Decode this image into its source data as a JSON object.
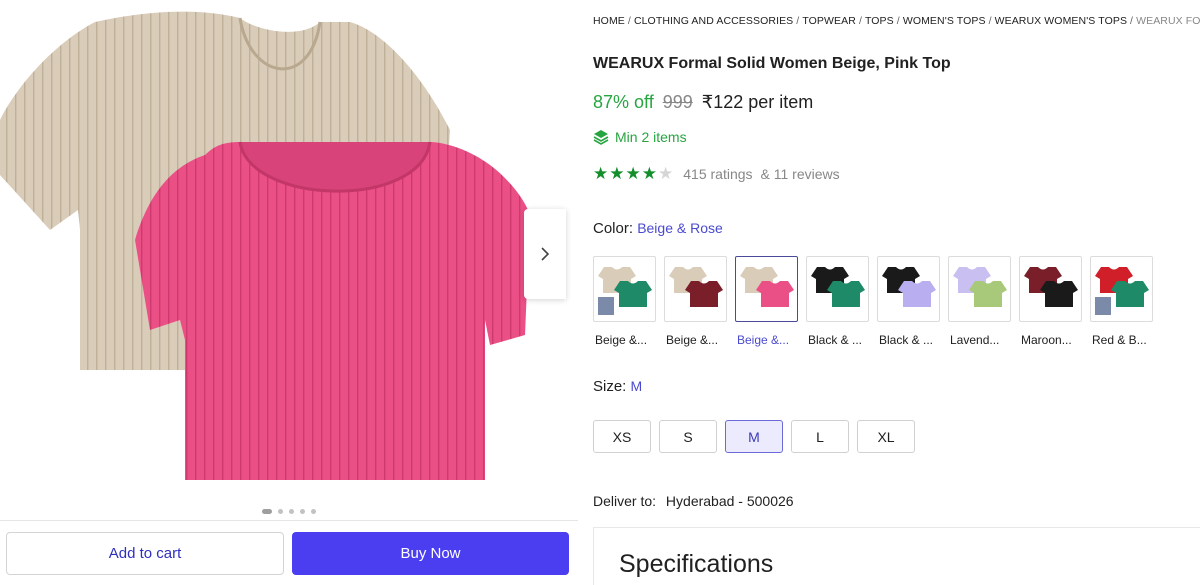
{
  "product": {
    "breadcrumb": [
      "HOME",
      "CLOTHING AND ACCESSORIES",
      "TOPWEAR",
      "TOPS",
      "WOMEN'S TOPS",
      "WEARUX WOMEN'S TOPS",
      "WEARUX FORMAL"
    ],
    "title": "WEARUX Formal Solid Women Beige, Pink Top",
    "discount": "87% off",
    "mrp": "999",
    "price": "₹122 per item",
    "min_items": "Min 2 items",
    "rating": 4,
    "rating_max": 5,
    "ratings_text": "415 ratings",
    "reviews_text": "& 11 reviews"
  },
  "gallery": {
    "image_count": 5,
    "active_index": 0,
    "main_colors": {
      "back_top": "#d9ccb9",
      "front_top": "#ea4f85"
    }
  },
  "color": {
    "label": "Color:",
    "selected": "Beige & Rose",
    "options": [
      {
        "name": "Beige &...",
        "c1": "#d9ccb9",
        "c2": "#1f8a68",
        "extra": true
      },
      {
        "name": "Beige &...",
        "c1": "#d9ccb9",
        "c2": "#7a1f2a",
        "extra": false
      },
      {
        "name": "Beige &...",
        "c1": "#d9ccb9",
        "c2": "#ea4f85",
        "extra": false,
        "selected": true
      },
      {
        "name": "Black & ...",
        "c1": "#1a1a1a",
        "c2": "#1f8a68",
        "extra": false
      },
      {
        "name": "Black & ...",
        "c1": "#1a1a1a",
        "c2": "#b9aef0",
        "extra": false
      },
      {
        "name": "Lavend...",
        "c1": "#c9bff0",
        "c2": "#a8c97a",
        "extra": false
      },
      {
        "name": "Maroon...",
        "c1": "#7a1f2a",
        "c2": "#1a1a1a",
        "extra": false
      },
      {
        "name": "Red & B...",
        "c1": "#d11f2a",
        "c2": "#1f8a68",
        "extra": true
      }
    ]
  },
  "size": {
    "label": "Size:",
    "selected": "M",
    "options": [
      "XS",
      "S",
      "M",
      "L",
      "XL"
    ]
  },
  "delivery": {
    "label": "Deliver to:",
    "location": "Hyderabad - 500026"
  },
  "actions": {
    "add_to_cart": "Add to cart",
    "buy_now": "Buy Now"
  },
  "specifications": {
    "title": "Specifications"
  }
}
